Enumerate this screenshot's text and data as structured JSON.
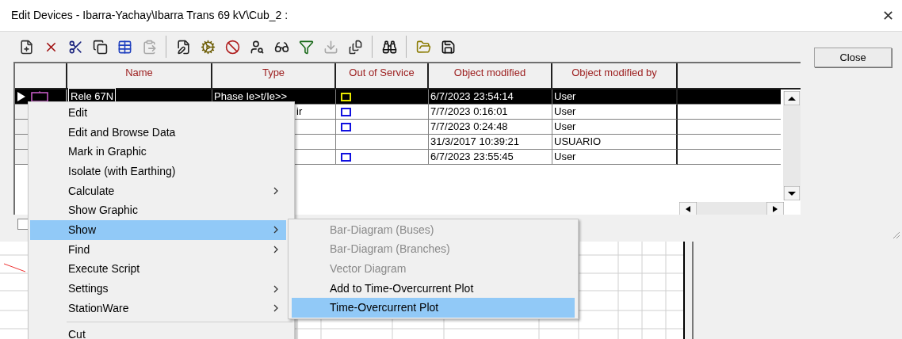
{
  "window": {
    "title": "Edit Devices - Ibarra-Yachay\\Ibarra Trans 69 kV\\Cub_2 :",
    "close": "✕"
  },
  "toolbar": [
    {
      "disabled": false
    },
    {
      "disabled": false
    },
    {
      "disabled": false
    },
    {
      "disabled": false
    },
    {
      "disabled": false
    },
    {
      "disabled": true
    },
    {
      "disabled": false
    },
    {
      "disabled": false
    },
    {
      "disabled": false
    },
    {
      "disabled": false
    },
    {
      "disabled": false
    },
    {
      "disabled": false
    },
    {
      "disabled": true
    },
    {
      "disabled": false
    },
    {
      "disabled": false
    },
    {
      "disabled": false
    },
    {
      "disabled": false
    }
  ],
  "close_button": "Close",
  "bottom_checkbox": {
    "checked": false
  },
  "table": {
    "columns": [
      "Name",
      "Type",
      "Out of Service",
      "Object modified",
      "Object modified by"
    ],
    "rows": [
      {
        "selected": true,
        "name": "Rele 67N",
        "type": "Phase Ie>t/Ie>>",
        "out_of_service": false,
        "modified": "6/7/2023 23:54:14",
        "modified_by": "User"
      },
      {
        "selected": false,
        "type": "ir",
        "out_of_service": false,
        "modified": "7/7/2023 0:16:01",
        "modified_by": "User"
      },
      {
        "selected": false,
        "out_of_service": false,
        "modified": "7/7/2023 0:24:48",
        "modified_by": "User"
      },
      {
        "selected": false,
        "modified": "31/3/2017 10:39:21",
        "modified_by": "USUARIO"
      },
      {
        "selected": false,
        "out_of_service": false,
        "modified": "6/7/2023 23:55:45",
        "modified_by": "User"
      }
    ]
  },
  "context_menu": {
    "items": [
      {
        "kind": "item",
        "label": "Edit",
        "submenu": false,
        "selected": false
      },
      {
        "kind": "item",
        "label": "Edit and Browse Data",
        "submenu": false,
        "selected": false
      },
      {
        "kind": "item",
        "label": "Mark in Graphic",
        "submenu": false,
        "selected": false
      },
      {
        "kind": "item",
        "label": "Isolate (with Earthing)",
        "submenu": false,
        "selected": false
      },
      {
        "kind": "item",
        "label": "Calculate",
        "submenu": true,
        "selected": false
      },
      {
        "kind": "item",
        "label": "Show Graphic",
        "submenu": false,
        "selected": false
      },
      {
        "kind": "item",
        "label": "Show",
        "submenu": true,
        "selected": true
      },
      {
        "kind": "item",
        "label": "Find",
        "submenu": true,
        "selected": false
      },
      {
        "kind": "item",
        "label": "Execute Script",
        "submenu": false,
        "selected": false
      },
      {
        "kind": "item",
        "label": "Settings",
        "submenu": true,
        "selected": false
      },
      {
        "kind": "item",
        "label": "StationWare",
        "submenu": true,
        "selected": false
      },
      {
        "kind": "separator"
      },
      {
        "kind": "item",
        "label": "Cut",
        "submenu": false,
        "selected": false
      }
    ]
  },
  "submenu": {
    "items": [
      {
        "label": "Bar-Diagram (Buses)",
        "disabled": true,
        "selected": false
      },
      {
        "label": "Bar-Diagram (Branches)",
        "disabled": true,
        "selected": false
      },
      {
        "label": "Vector Diagram",
        "disabled": true,
        "selected": false
      },
      {
        "label": "Add to Time-Overcurrent Plot",
        "disabled": false,
        "selected": false
      },
      {
        "label": "Time-Overcurrent Plot",
        "disabled": false,
        "selected": true
      }
    ]
  }
}
